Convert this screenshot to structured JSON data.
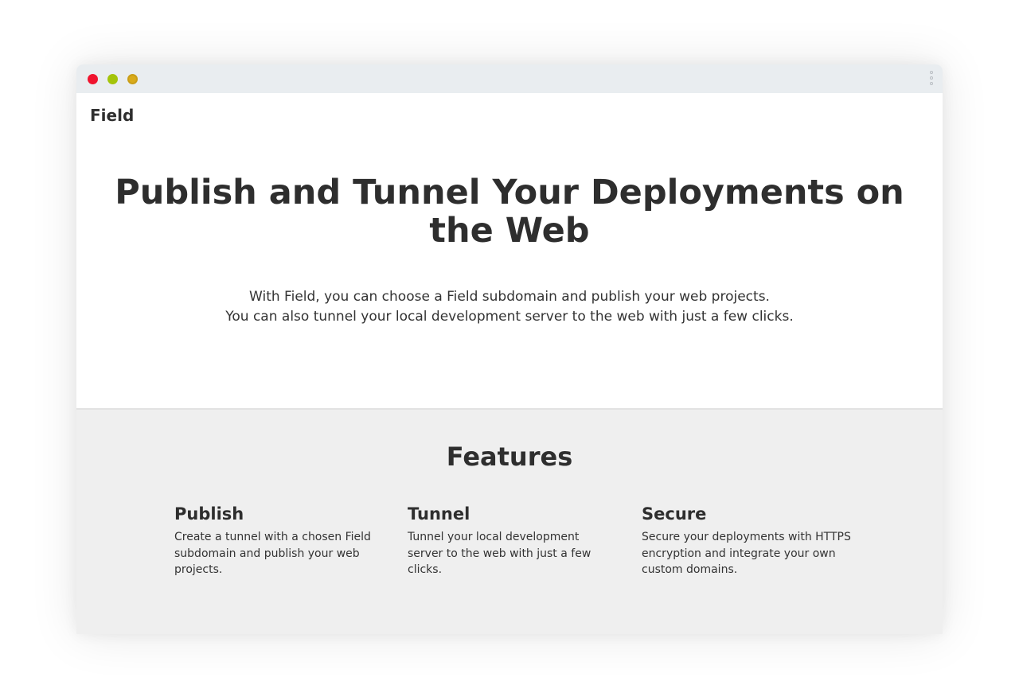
{
  "window": {
    "controls": {
      "close_color": "#f0142f",
      "minimize_color": "#a4c40a",
      "maximize_color": "#d9ab1a"
    },
    "menu_icon": "vertical-dots-icon"
  },
  "header": {
    "brand": "Field"
  },
  "hero": {
    "title": "Publish and Tunnel Your Deployments on the Web",
    "subtitle_line1": "With Field, you can choose a Field subdomain and publish your web projects.",
    "subtitle_line2": "You can also tunnel your local development server to the web with just a few clicks."
  },
  "features": {
    "title": "Features",
    "items": [
      {
        "title": "Publish",
        "description": "Create a tunnel with a chosen Field subdomain and publish your web projects."
      },
      {
        "title": "Tunnel",
        "description": "Tunnel your local development server to the web with just a few clicks."
      },
      {
        "title": "Secure",
        "description": "Secure your deployments with HTTPS encryption and integrate your own custom domains."
      }
    ]
  }
}
